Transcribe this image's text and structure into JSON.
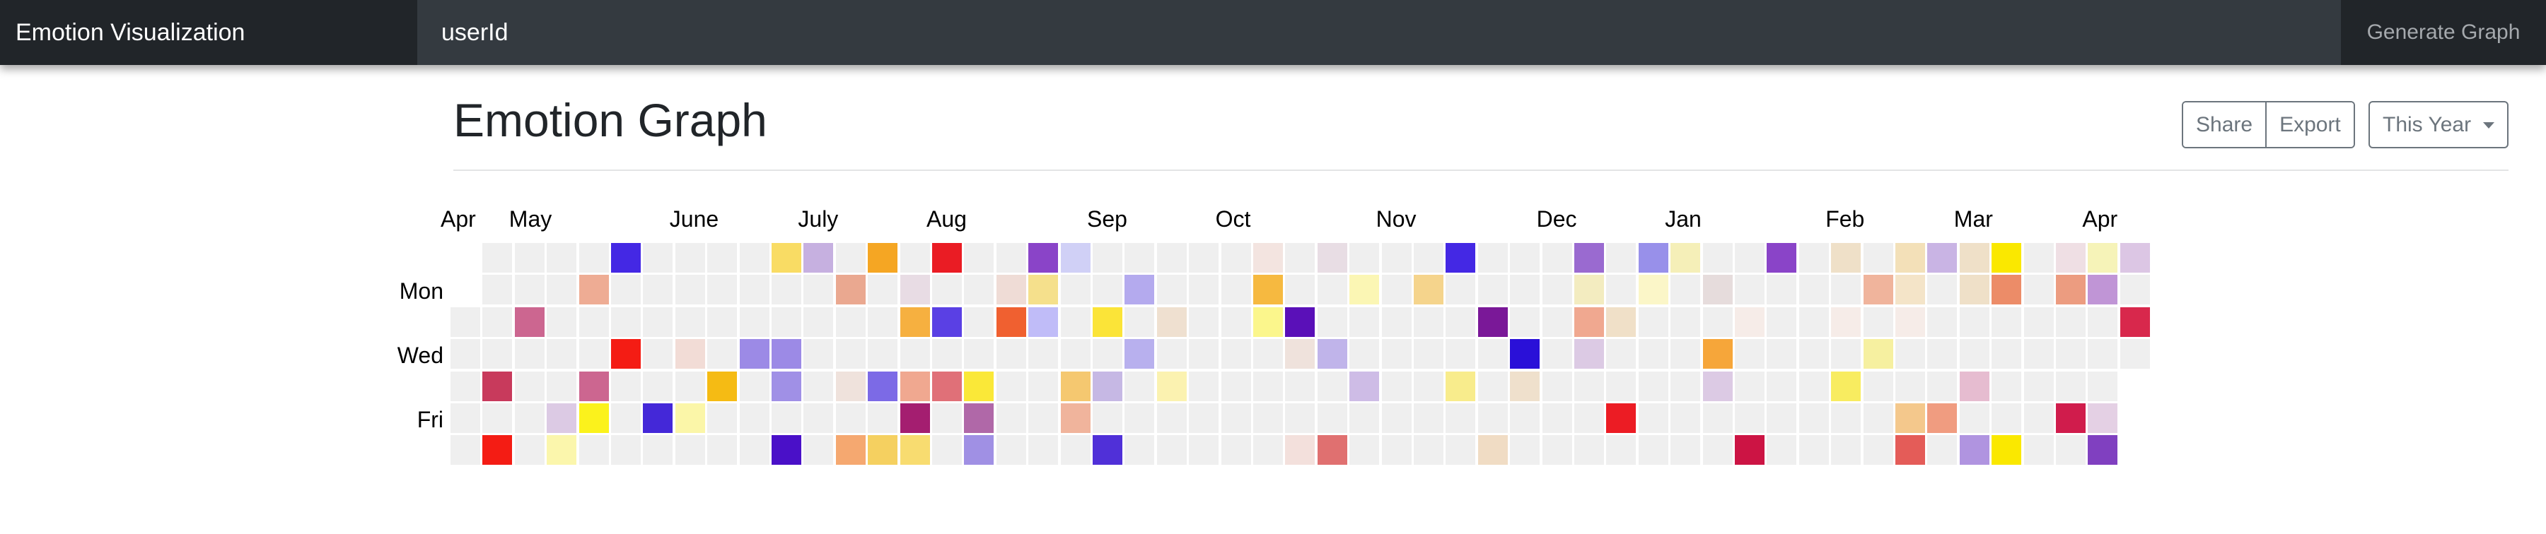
{
  "navbar": {
    "brand": "Emotion Visualization",
    "search_placeholder": "userId",
    "generate_label": "Generate Graph"
  },
  "header": {
    "title": "Emotion Graph",
    "share_label": "Share",
    "export_label": "Export",
    "year_label": "This Year"
  },
  "calendar": {
    "months": [
      {
        "label": "Apr",
        "week": 0
      },
      {
        "label": "May",
        "week": 2
      },
      {
        "label": "June",
        "week": 7
      },
      {
        "label": "July",
        "week": 11
      },
      {
        "label": "Aug",
        "week": 15
      },
      {
        "label": "Sep",
        "week": 20
      },
      {
        "label": "Oct",
        "week": 24
      },
      {
        "label": "Nov",
        "week": 29
      },
      {
        "label": "Dec",
        "week": 34
      },
      {
        "label": "Jan",
        "week": 38
      },
      {
        "label": "Feb",
        "week": 43
      },
      {
        "label": "Mar",
        "week": 47
      },
      {
        "label": "Apr",
        "week": 51
      }
    ],
    "day_labels": [
      {
        "label": "Mon",
        "row": 1
      },
      {
        "label": "Wed",
        "row": 3
      },
      {
        "label": "Fri",
        "row": 5
      }
    ],
    "weeks": 53,
    "first_week_start_row": 2,
    "empty_color": "#efefef",
    "colored_cells": [
      {
        "w": 5,
        "r": 0,
        "c": "#4428e4"
      },
      {
        "w": 10,
        "r": 0,
        "c": "#f9dc64"
      },
      {
        "w": 11,
        "r": 0,
        "c": "#c6b0e0"
      },
      {
        "w": 13,
        "r": 0,
        "c": "#f5a623"
      },
      {
        "w": 15,
        "r": 0,
        "c": "#ea1c24"
      },
      {
        "w": 18,
        "r": 0,
        "c": "#8a44c8"
      },
      {
        "w": 19,
        "r": 0,
        "c": "#d0d0f6"
      },
      {
        "w": 25,
        "r": 0,
        "c": "#f3e4e0"
      },
      {
        "w": 27,
        "r": 0,
        "c": "#e8dde4"
      },
      {
        "w": 31,
        "r": 0,
        "c": "#4428e4"
      },
      {
        "w": 35,
        "r": 0,
        "c": "#9a6ad0"
      },
      {
        "w": 37,
        "r": 0,
        "c": "#9890ea"
      },
      {
        "w": 38,
        "r": 0,
        "c": "#f5efb8"
      },
      {
        "w": 41,
        "r": 0,
        "c": "#8a44c8"
      },
      {
        "w": 43,
        "r": 0,
        "c": "#efe0c8"
      },
      {
        "w": 45,
        "r": 0,
        "c": "#f3e0b8"
      },
      {
        "w": 46,
        "r": 0,
        "c": "#c9b4e4"
      },
      {
        "w": 47,
        "r": 0,
        "c": "#efe0c8"
      },
      {
        "w": 48,
        "r": 0,
        "c": "#fae800"
      },
      {
        "w": 50,
        "r": 0,
        "c": "#efdfe4"
      },
      {
        "w": 51,
        "r": 0,
        "c": "#f6f3b8"
      },
      {
        "w": 52,
        "r": 0,
        "c": "#dcc6e4"
      },
      {
        "w": 4,
        "r": 1,
        "c": "#eeac94"
      },
      {
        "w": 12,
        "r": 1,
        "c": "#eaa890"
      },
      {
        "w": 14,
        "r": 1,
        "c": "#e8dce4"
      },
      {
        "w": 17,
        "r": 1,
        "c": "#efdcd6"
      },
      {
        "w": 18,
        "r": 1,
        "c": "#f5e08c"
      },
      {
        "w": 21,
        "r": 1,
        "c": "#b4aaee"
      },
      {
        "w": 25,
        "r": 1,
        "c": "#f6b940"
      },
      {
        "w": 28,
        "r": 1,
        "c": "#fbf6b4"
      },
      {
        "w": 30,
        "r": 1,
        "c": "#f5d48c"
      },
      {
        "w": 35,
        "r": 1,
        "c": "#f3ecc0"
      },
      {
        "w": 37,
        "r": 1,
        "c": "#fbf6c8"
      },
      {
        "w": 39,
        "r": 1,
        "c": "#e6dcdc"
      },
      {
        "w": 44,
        "r": 1,
        "c": "#f0b49c"
      },
      {
        "w": 45,
        "r": 1,
        "c": "#f4e4c8"
      },
      {
        "w": 47,
        "r": 1,
        "c": "#efe0c8"
      },
      {
        "w": 48,
        "r": 1,
        "c": "#ec8c68"
      },
      {
        "w": 50,
        "r": 1,
        "c": "#ec9c80"
      },
      {
        "w": 51,
        "r": 1,
        "c": "#c095d6"
      },
      {
        "w": 2,
        "r": 2,
        "c": "#cc6690"
      },
      {
        "w": 14,
        "r": 2,
        "c": "#f6b040"
      },
      {
        "w": 15,
        "r": 2,
        "c": "#5a40e4"
      },
      {
        "w": 17,
        "r": 2,
        "c": "#f06030"
      },
      {
        "w": 18,
        "r": 2,
        "c": "#c0bcf8"
      },
      {
        "w": 20,
        "r": 2,
        "c": "#fbe438"
      },
      {
        "w": 22,
        "r": 2,
        "c": "#efe0d0"
      },
      {
        "w": 25,
        "r": 2,
        "c": "#fbf68c"
      },
      {
        "w": 26,
        "r": 2,
        "c": "#5a10b8"
      },
      {
        "w": 32,
        "r": 2,
        "c": "#7a1898"
      },
      {
        "w": 35,
        "r": 2,
        "c": "#f0a890"
      },
      {
        "w": 36,
        "r": 2,
        "c": "#f0e0c8"
      },
      {
        "w": 40,
        "r": 2,
        "c": "#f6ece8"
      },
      {
        "w": 43,
        "r": 2,
        "c": "#f6ece8"
      },
      {
        "w": 45,
        "r": 2,
        "c": "#f6ece8"
      },
      {
        "w": 52,
        "r": 2,
        "c": "#d8284c"
      },
      {
        "w": 5,
        "r": 3,
        "c": "#f41c14"
      },
      {
        "w": 7,
        "r": 3,
        "c": "#f2dcd6"
      },
      {
        "w": 9,
        "r": 3,
        "c": "#9c8ae6"
      },
      {
        "w": 10,
        "r": 3,
        "c": "#9c8ae6"
      },
      {
        "w": 21,
        "r": 3,
        "c": "#b8b0ee"
      },
      {
        "w": 26,
        "r": 3,
        "c": "#efe2dc"
      },
      {
        "w": 27,
        "r": 3,
        "c": "#c0b4ea"
      },
      {
        "w": 33,
        "r": 3,
        "c": "#2a10d8"
      },
      {
        "w": 35,
        "r": 3,
        "c": "#dccae4"
      },
      {
        "w": 39,
        "r": 3,
        "c": "#f6a63a"
      },
      {
        "w": 44,
        "r": 3,
        "c": "#f6f0a0"
      },
      {
        "w": 1,
        "r": 4,
        "c": "#c83a5c"
      },
      {
        "w": 4,
        "r": 4,
        "c": "#cc6690"
      },
      {
        "w": 8,
        "r": 4,
        "c": "#f5bb14"
      },
      {
        "w": 10,
        "r": 4,
        "c": "#a090e6"
      },
      {
        "w": 12,
        "r": 4,
        "c": "#efe2dc"
      },
      {
        "w": 13,
        "r": 4,
        "c": "#7c6ae6"
      },
      {
        "w": 14,
        "r": 4,
        "c": "#f0a890"
      },
      {
        "w": 15,
        "r": 4,
        "c": "#e07078"
      },
      {
        "w": 16,
        "r": 4,
        "c": "#fae838"
      },
      {
        "w": 19,
        "r": 4,
        "c": "#f5c870"
      },
      {
        "w": 20,
        "r": 4,
        "c": "#c6b8e4"
      },
      {
        "w": 22,
        "r": 4,
        "c": "#fbf2b0"
      },
      {
        "w": 28,
        "r": 4,
        "c": "#cebce6"
      },
      {
        "w": 31,
        "r": 4,
        "c": "#f8ec8c"
      },
      {
        "w": 33,
        "r": 4,
        "c": "#efe0cc"
      },
      {
        "w": 39,
        "r": 4,
        "c": "#dccae4"
      },
      {
        "w": 43,
        "r": 4,
        "c": "#f8ec60"
      },
      {
        "w": 47,
        "r": 4,
        "c": "#e6bcd0"
      },
      {
        "w": 3,
        "r": 5,
        "c": "#dccae4"
      },
      {
        "w": 4,
        "r": 5,
        "c": "#fbf21c"
      },
      {
        "w": 6,
        "r": 5,
        "c": "#4428d8"
      },
      {
        "w": 7,
        "r": 5,
        "c": "#fbf6a8"
      },
      {
        "w": 14,
        "r": 5,
        "c": "#a41e70"
      },
      {
        "w": 16,
        "r": 5,
        "c": "#b068a8"
      },
      {
        "w": 19,
        "r": 5,
        "c": "#f0b49c"
      },
      {
        "w": 36,
        "r": 5,
        "c": "#ec1c24"
      },
      {
        "w": 45,
        "r": 5,
        "c": "#f4c88c"
      },
      {
        "w": 46,
        "r": 5,
        "c": "#f09c80"
      },
      {
        "w": 50,
        "r": 5,
        "c": "#d01c4c"
      },
      {
        "w": 51,
        "r": 5,
        "c": "#e4d0e4"
      },
      {
        "w": 1,
        "r": 6,
        "c": "#f41c14"
      },
      {
        "w": 3,
        "r": 6,
        "c": "#fbf6ac"
      },
      {
        "w": 10,
        "r": 6,
        "c": "#4a10c8"
      },
      {
        "w": 12,
        "r": 6,
        "c": "#f5a870"
      },
      {
        "w": 13,
        "r": 6,
        "c": "#f5d060"
      },
      {
        "w": 14,
        "r": 6,
        "c": "#f8dc70"
      },
      {
        "w": 16,
        "r": 6,
        "c": "#a090e4"
      },
      {
        "w": 20,
        "r": 6,
        "c": "#5030d8"
      },
      {
        "w": 26,
        "r": 6,
        "c": "#f3e0dc"
      },
      {
        "w": 27,
        "r": 6,
        "c": "#e07070"
      },
      {
        "w": 32,
        "r": 6,
        "c": "#f0dcc4"
      },
      {
        "w": 40,
        "r": 6,
        "c": "#cc1444"
      },
      {
        "w": 45,
        "r": 6,
        "c": "#e45c58"
      },
      {
        "w": 47,
        "r": 6,
        "c": "#b094e0"
      },
      {
        "w": 48,
        "r": 6,
        "c": "#fae800"
      },
      {
        "w": 51,
        "r": 6,
        "c": "#8040c0"
      }
    ]
  }
}
